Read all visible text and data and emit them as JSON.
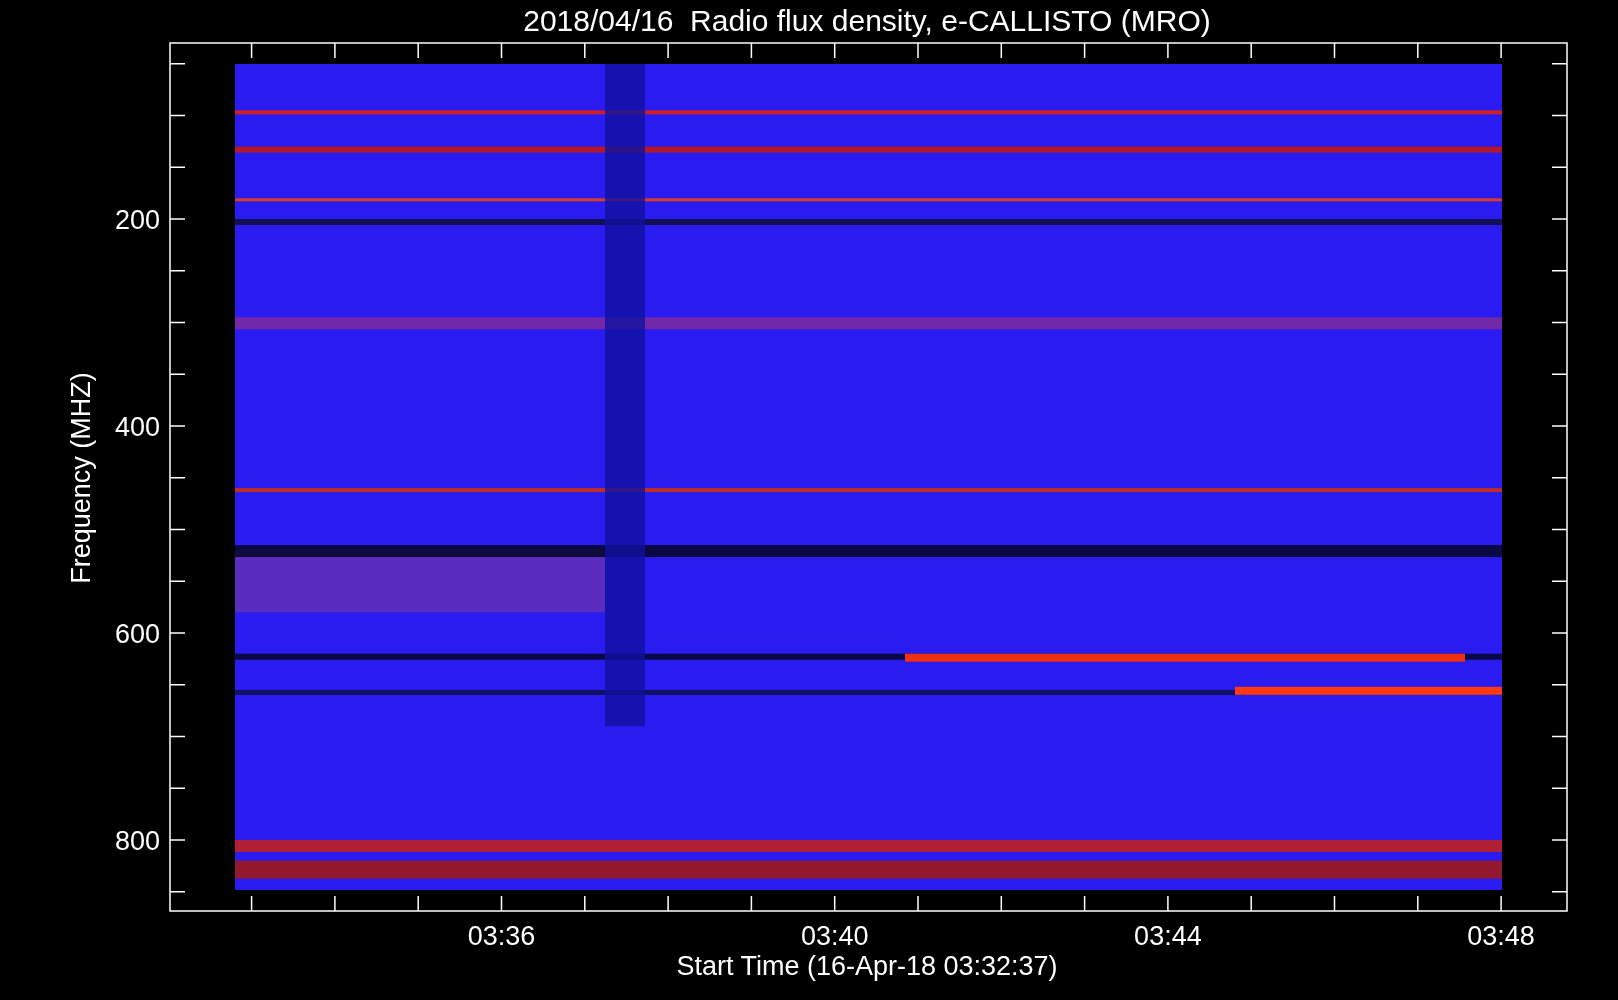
{
  "title": "2018/04/16  Radio flux density, e-CALLISTO (MRO)",
  "y_axis": {
    "label": "Frequency (MHZ)",
    "ticks": [
      "200",
      "400",
      "600",
      "800"
    ]
  },
  "x_axis": {
    "label": "Start Time (16-Apr-18 03:32:37)",
    "ticks": [
      "03:36",
      "03:40",
      "03:44",
      "03:48"
    ]
  }
}
